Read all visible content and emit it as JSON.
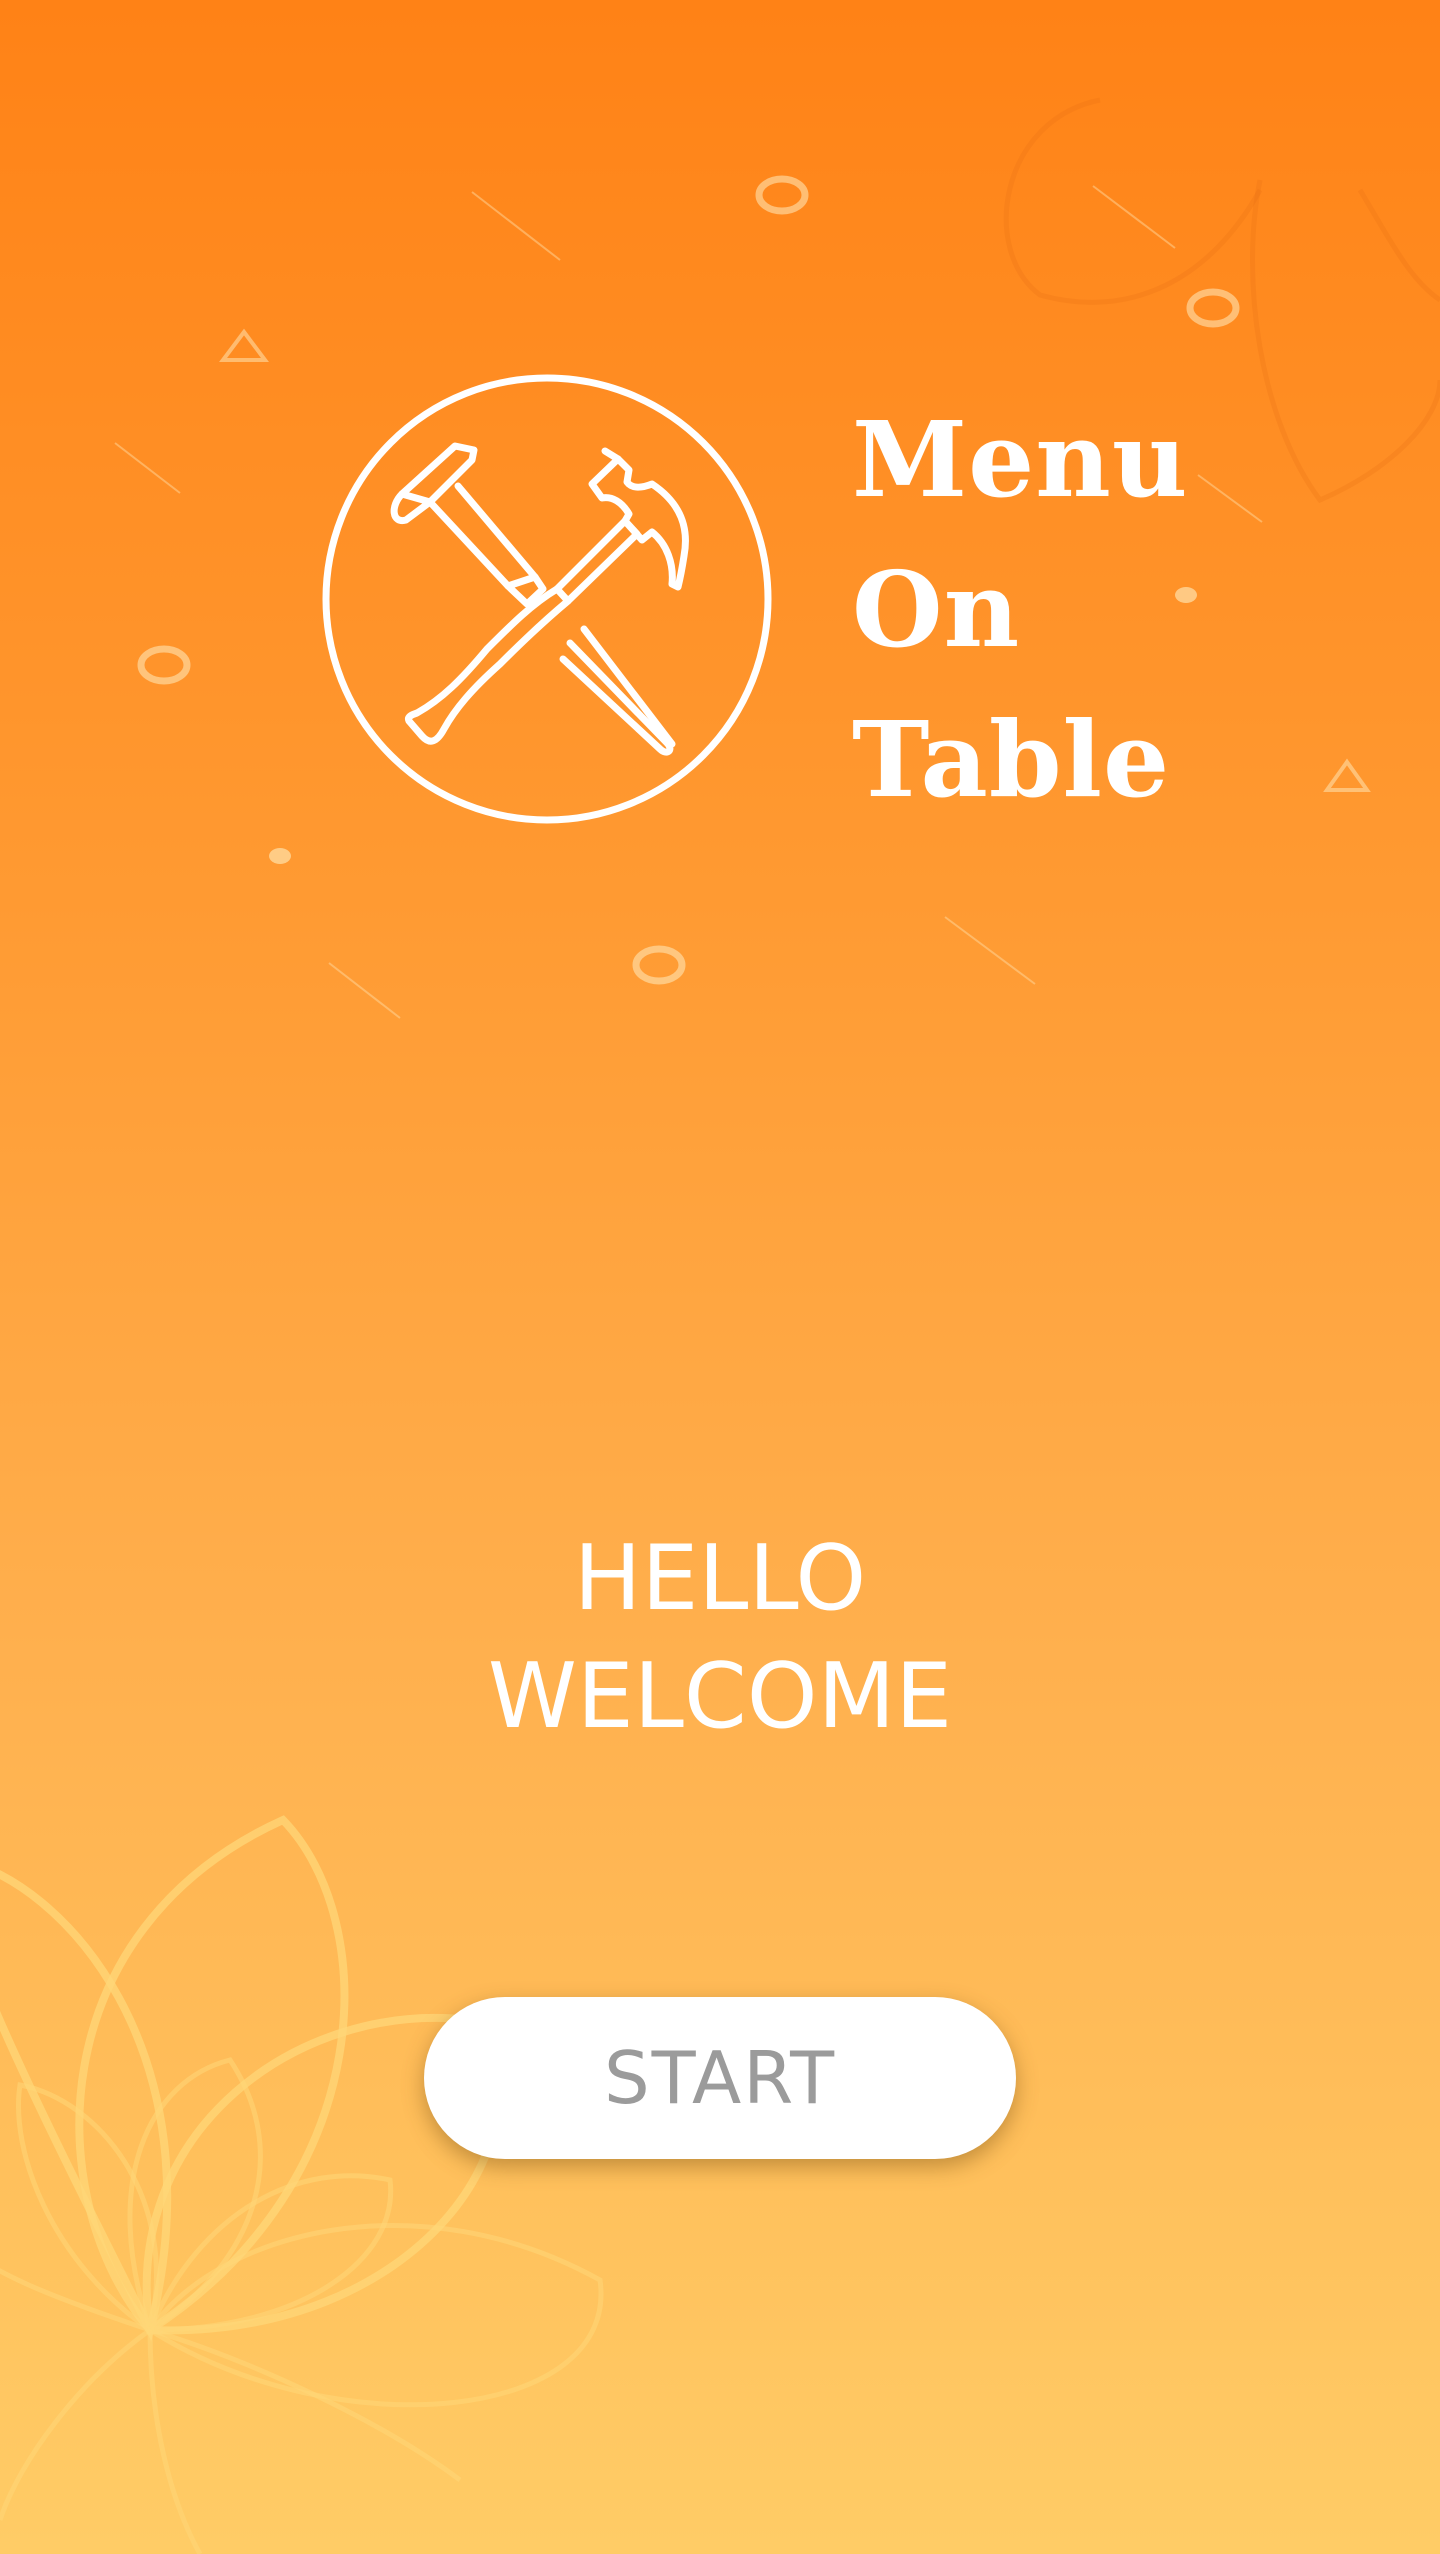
{
  "app": {
    "title_lines": [
      "Menu",
      "On",
      "Table"
    ]
  },
  "welcome": {
    "line1": "HELLO",
    "line2": "WELCOME"
  },
  "start_button": {
    "label": "START"
  },
  "icons": {
    "logo": "crossed-hammer-and-chisel-icon"
  },
  "colors": {
    "gradient_top": "#ff8216",
    "gradient_bottom": "#ffcc66",
    "text": "#ffffff",
    "button_bg": "#ffffff",
    "button_text": "#9b9b9b"
  }
}
